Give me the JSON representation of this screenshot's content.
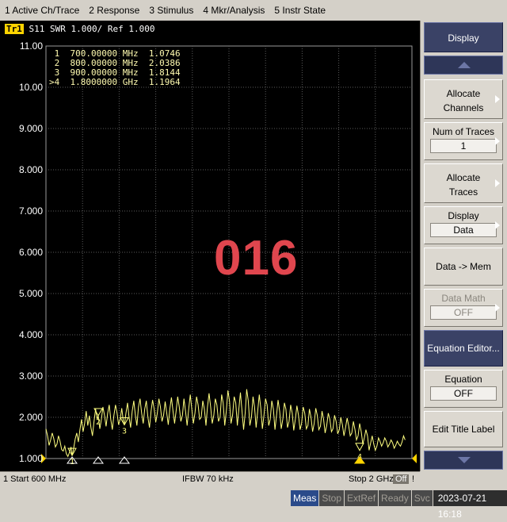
{
  "menubar": [
    "1 Active Ch/Trace",
    "2 Response",
    "3 Stimulus",
    "4 Mkr/Analysis",
    "5 Instr State"
  ],
  "trace": {
    "badge": "Tr1",
    "header": "S11  SWR 1.000/ Ref 1.000"
  },
  "markers": [
    {
      "label": " 1",
      "freq": "700.00000 MHz",
      "value": "1.0746"
    },
    {
      "label": " 2",
      "freq": "800.00000 MHz",
      "value": "2.0386"
    },
    {
      "label": " 3",
      "freq": "900.00000 MHz",
      "value": "1.8144"
    },
    {
      "label": ">4",
      "freq": "1.8000000 GHz",
      "value": "1.1964"
    }
  ],
  "overlay_number": "016",
  "chart_data": {
    "type": "line",
    "ylim": [
      1.0,
      11.0
    ],
    "xlim_mhz": [
      600,
      2000
    ],
    "y_ticks": [
      "11.00",
      "10.00",
      "9.000",
      "8.000",
      "7.000",
      "6.000",
      "5.000",
      "4.000",
      "3.000",
      "2.000",
      "1.000"
    ],
    "grid": true,
    "series": [
      {
        "color": "#ffff80",
        "x_mhz": [
          600,
          606,
          612,
          618,
          624,
          630,
          636,
          642,
          648,
          654,
          660,
          666,
          672,
          678,
          684,
          690,
          696,
          700,
          706,
          712,
          718,
          724,
          730,
          736,
          742,
          748,
          754,
          760,
          766,
          772,
          778,
          784,
          790,
          796,
          800,
          806,
          812,
          818,
          824,
          830,
          836,
          842,
          848,
          854,
          860,
          866,
          872,
          878,
          884,
          890,
          896,
          900,
          906,
          912,
          918,
          924,
          930,
          936,
          942,
          948,
          954,
          960,
          966,
          972,
          978,
          984,
          990,
          996,
          1002,
          1008,
          1014,
          1020,
          1026,
          1032,
          1038,
          1044,
          1050,
          1056,
          1062,
          1068,
          1074,
          1080,
          1086,
          1092,
          1098,
          1104,
          1110,
          1116,
          1122,
          1128,
          1134,
          1140,
          1146,
          1152,
          1158,
          1164,
          1170,
          1176,
          1182,
          1188,
          1194,
          1200,
          1206,
          1212,
          1218,
          1224,
          1230,
          1236,
          1242,
          1248,
          1254,
          1260,
          1266,
          1272,
          1278,
          1284,
          1290,
          1296,
          1302,
          1308,
          1314,
          1320,
          1326,
          1332,
          1338,
          1344,
          1350,
          1356,
          1362,
          1368,
          1374,
          1380,
          1386,
          1392,
          1398,
          1404,
          1410,
          1416,
          1422,
          1428,
          1434,
          1440,
          1446,
          1452,
          1458,
          1464,
          1470,
          1476,
          1482,
          1488,
          1494,
          1500,
          1506,
          1512,
          1518,
          1524,
          1530,
          1536,
          1542,
          1548,
          1554,
          1560,
          1566,
          1572,
          1578,
          1584,
          1590,
          1596,
          1602,
          1608,
          1614,
          1620,
          1626,
          1632,
          1638,
          1644,
          1650,
          1656,
          1662,
          1668,
          1674,
          1680,
          1686,
          1692,
          1698,
          1704,
          1710,
          1716,
          1722,
          1728,
          1734,
          1740,
          1746,
          1752,
          1758,
          1764,
          1770,
          1776,
          1782,
          1788,
          1794,
          1800,
          1806,
          1812,
          1818,
          1824,
          1830,
          1836,
          1842,
          1848,
          1854,
          1860,
          1866,
          1872,
          1878,
          1884,
          1890,
          1896,
          1902,
          1908,
          1914,
          1920,
          1926,
          1932,
          1938,
          1944,
          1950,
          1956,
          1962,
          1968,
          1974,
          1980,
          1986,
          1992,
          2000
        ],
        "y": [
          1.72,
          1.55,
          1.32,
          1.45,
          1.62,
          1.48,
          1.28,
          1.35,
          1.55,
          1.42,
          1.22,
          1.18,
          1.3,
          1.12,
          1.05,
          1.15,
          1.28,
          1.07,
          1.25,
          1.48,
          1.62,
          1.4,
          1.7,
          1.95,
          1.65,
          1.85,
          2.15,
          1.8,
          2.04,
          1.75,
          1.55,
          1.9,
          2.2,
          1.95,
          2.04,
          1.72,
          1.95,
          2.25,
          2.05,
          1.78,
          2.1,
          2.3,
          1.95,
          1.7,
          2.05,
          2.3,
          2.1,
          1.82,
          1.95,
          2.22,
          1.9,
          1.81,
          2.1,
          2.35,
          2.0,
          1.75,
          2.15,
          2.4,
          2.05,
          1.8,
          2.25,
          2.45,
          2.1,
          1.85,
          2.2,
          2.4,
          2.0,
          1.75,
          2.15,
          2.42,
          2.2,
          1.88,
          2.1,
          2.45,
          2.25,
          1.9,
          2.05,
          2.38,
          2.1,
          1.82,
          2.2,
          2.48,
          2.15,
          1.85,
          2.15,
          2.5,
          2.25,
          1.9,
          2.05,
          2.45,
          2.15,
          1.8,
          2.2,
          2.55,
          2.2,
          1.85,
          2.1,
          2.5,
          2.3,
          1.95,
          2.0,
          2.4,
          2.2,
          1.8,
          2.25,
          2.58,
          2.25,
          1.85,
          2.05,
          2.45,
          2.3,
          1.9,
          2.0,
          2.55,
          2.35,
          1.8,
          2.15,
          2.65,
          2.4,
          1.85,
          2.05,
          2.5,
          2.35,
          1.8,
          2.2,
          2.6,
          2.15,
          1.7,
          2.1,
          2.68,
          2.4,
          1.8,
          2.0,
          2.5,
          2.25,
          1.75,
          2.15,
          2.55,
          2.2,
          1.72,
          2.05,
          2.45,
          2.3,
          1.8,
          1.95,
          2.4,
          2.2,
          1.7,
          2.05,
          2.42,
          2.15,
          1.72,
          1.95,
          2.35,
          2.2,
          1.75,
          1.9,
          2.3,
          2.1,
          1.68,
          1.95,
          2.28,
          2.05,
          1.7,
          1.85,
          2.25,
          2.1,
          1.72,
          1.8,
          2.2,
          2.0,
          1.65,
          1.85,
          2.22,
          2.05,
          1.7,
          1.78,
          2.15,
          1.95,
          1.62,
          1.8,
          2.1,
          1.95,
          1.65,
          1.72,
          2.05,
          1.9,
          1.6,
          1.7,
          2.0,
          1.82,
          1.55,
          1.75,
          1.98,
          1.8,
          1.55,
          1.62,
          1.9,
          1.7,
          1.45,
          1.55,
          1.85,
          1.65,
          1.35,
          1.5,
          1.7,
          1.55,
          1.2,
          1.38,
          1.55,
          1.35,
          1.2,
          1.3,
          1.5,
          1.42,
          1.3,
          1.38,
          1.5,
          1.42,
          1.28,
          1.35,
          1.45,
          1.38,
          1.25,
          1.32,
          1.42,
          1.35,
          1.3,
          1.4,
          1.55,
          1.45
        ]
      }
    ],
    "marker_points": [
      {
        "label": "1",
        "x_mhz": 700,
        "y": 1.0746
      },
      {
        "label": "2",
        "x_mhz": 800,
        "y": 2.0386
      },
      {
        "label": "3",
        "x_mhz": 900,
        "y": 1.8144
      },
      {
        "label": "4",
        "x_mhz": 1800,
        "y": 1.1964
      }
    ]
  },
  "softkeys": {
    "title": "Display",
    "allocate_channels": "Allocate Channels",
    "num_of_traces": "Num of Traces",
    "num_of_traces_value": "1",
    "allocate_traces": "Allocate Traces",
    "display": "Display",
    "display_value": "Data",
    "data_to_mem": "Data -> Mem",
    "data_math": "Data Math",
    "data_math_value": "OFF",
    "equation_editor": "Equation Editor...",
    "equation": "Equation",
    "equation_value": "OFF",
    "edit_title_label": "Edit Title Label"
  },
  "footer": {
    "start": "1  Start 600 MHz",
    "ifbw": "IFBW 70 kHz",
    "stop": "Stop 2 GHz",
    "off": "Off",
    "bang": "!"
  },
  "status": {
    "meas": "Meas",
    "stop": "Stop",
    "extref": "ExtRef",
    "ready": "Ready",
    "svc": "Svc",
    "datetime": "2023-07-21 16:18"
  }
}
